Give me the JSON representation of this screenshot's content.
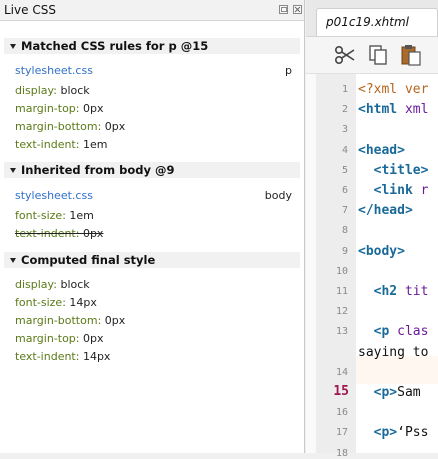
{
  "live_css": {
    "title": "Live CSS",
    "sections": [
      {
        "header": "Matched CSS rules for p @15",
        "source": "stylesheet.css",
        "selector": "p",
        "props": [
          {
            "name": "display",
            "value": "block"
          },
          {
            "name": "margin-top",
            "value": "0px"
          },
          {
            "name": "margin-bottom",
            "value": "0px"
          },
          {
            "name": "text-indent",
            "value": "1em"
          }
        ]
      },
      {
        "header": "Inherited from body @9",
        "source": "stylesheet.css",
        "selector": "body",
        "props": [
          {
            "name": "font-size",
            "value": "1em"
          },
          {
            "name": "text-indent",
            "value": "0px",
            "overridden": true
          }
        ]
      },
      {
        "header": "Computed final style",
        "props": [
          {
            "name": "display",
            "value": "block"
          },
          {
            "name": "font-size",
            "value": "14px"
          },
          {
            "name": "margin-bottom",
            "value": "0px"
          },
          {
            "name": "margin-top",
            "value": "0px"
          },
          {
            "name": "text-indent",
            "value": "14px"
          }
        ]
      }
    ]
  },
  "editor": {
    "tab_label": "p01c19.xhtml",
    "toolbar": [
      {
        "icon": "scissors-icon"
      },
      {
        "icon": "copy-icon"
      },
      {
        "icon": "paste-icon"
      }
    ],
    "current_line": "15",
    "lines": [
      {
        "num": "1",
        "code": [
          {
            "t": "pi",
            "s": "<?xml ver"
          }
        ]
      },
      {
        "num": "2",
        "code": [
          {
            "t": "tag",
            "s": "<html"
          },
          {
            "t": "attr",
            "s": " xml"
          }
        ]
      },
      {
        "num": "3",
        "code": []
      },
      {
        "num": "4",
        "code": [
          {
            "t": "tag",
            "s": "<head>"
          }
        ]
      },
      {
        "num": "5",
        "code": [
          {
            "t": "txt",
            "s": "  "
          },
          {
            "t": "tag",
            "s": "<title>"
          }
        ]
      },
      {
        "num": "6",
        "code": [
          {
            "t": "txt",
            "s": "  "
          },
          {
            "t": "tag",
            "s": "<link"
          },
          {
            "t": "attr",
            "s": " r"
          }
        ]
      },
      {
        "num": "7",
        "code": [
          {
            "t": "tag",
            "s": "</head>"
          }
        ]
      },
      {
        "num": "8",
        "code": []
      },
      {
        "num": "9",
        "code": [
          {
            "t": "tag",
            "s": "<body>"
          }
        ]
      },
      {
        "num": "10",
        "code": []
      },
      {
        "num": "11",
        "code": [
          {
            "t": "txt",
            "s": "  "
          },
          {
            "t": "tag",
            "s": "<h2"
          },
          {
            "t": "attr",
            "s": " tit"
          }
        ]
      },
      {
        "num": "12",
        "code": []
      },
      {
        "num": "13",
        "code": [
          {
            "t": "txt",
            "s": "  "
          },
          {
            "t": "tag",
            "s": "<p"
          },
          {
            "t": "attr",
            "s": " clas"
          }
        ]
      },
      {
        "num": "",
        "code": [
          {
            "t": "txt",
            "s": "saying to"
          }
        ]
      },
      {
        "num": "14",
        "code": []
      },
      {
        "num": "15",
        "code": [
          {
            "t": "txt",
            "s": "  "
          },
          {
            "t": "tag",
            "s": "<p>"
          },
          {
            "t": "txt",
            "s": "Sam"
          }
        ]
      },
      {
        "num": "16",
        "code": []
      },
      {
        "num": "17",
        "code": [
          {
            "t": "txt",
            "s": "  "
          },
          {
            "t": "tag",
            "s": "<p>"
          },
          {
            "t": "txt",
            "s": "‘Pss"
          }
        ]
      },
      {
        "num": "18",
        "code": []
      }
    ]
  }
}
